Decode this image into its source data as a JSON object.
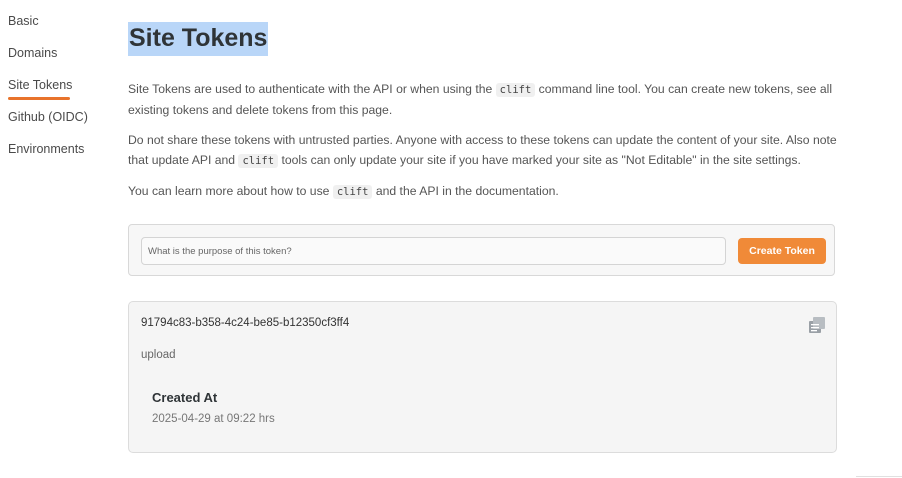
{
  "sidebar": {
    "items": [
      {
        "label": "Basic"
      },
      {
        "label": "Domains"
      },
      {
        "label": "Site Tokens"
      },
      {
        "label": "Github (OIDC)"
      },
      {
        "label": "Environments"
      }
    ]
  },
  "main": {
    "title": "Site Tokens",
    "para1": {
      "text_before": "Site Tokens are used to authenticate with the API or when using the ",
      "code": "clift",
      "text_after": " command line tool. You can create new tokens, see all existing tokens and delete tokens from this page."
    },
    "para2": {
      "text_before": "Do not share these tokens with untrusted parties. Anyone with access to these tokens can update the content of your site. Also note that update API and ",
      "code": "clift",
      "text_after": " tools can only update your site if you have marked your site as \"Not Editable\" in the site settings."
    },
    "para3": {
      "text_before": "You can learn more about how to use ",
      "code": "clift",
      "text_after": " and the API in the documentation."
    },
    "create_form": {
      "placeholder": "What is the purpose of this token?",
      "value": "",
      "button_label": "Create Token"
    },
    "tokens": [
      {
        "id": "91794c83-b358-4c24-be85-b12350cf3ff4",
        "purpose": "upload",
        "created_label": "Created At",
        "created_value": "2025-04-29 at 09:22 hrs",
        "copy_icon": "copy-icon"
      }
    ]
  },
  "colors": {
    "accent": "#f08a38",
    "title_highlight": "#b9d6f8",
    "active_underline": "#e8732b"
  }
}
